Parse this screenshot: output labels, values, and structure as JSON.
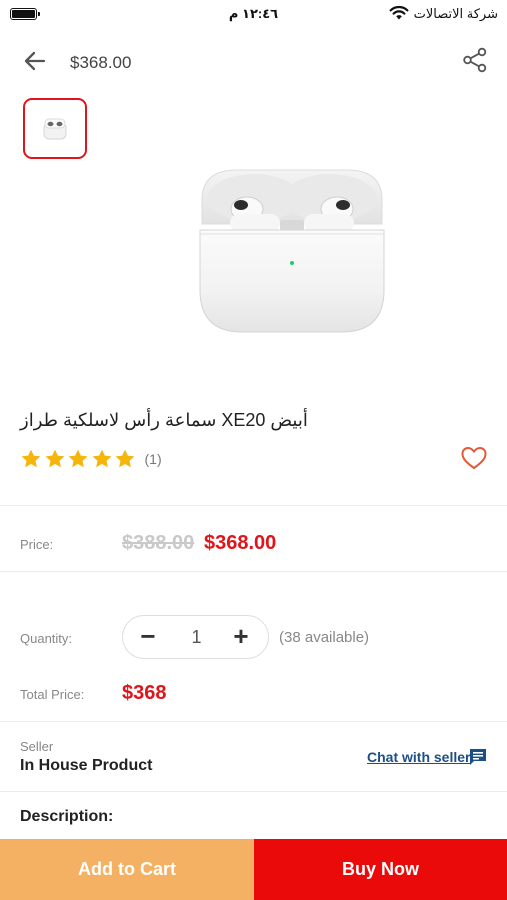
{
  "status_bar": {
    "carrier": "شركة الاتصالات",
    "time": "١٢:٤٦ م",
    "battery_icon": "battery-icon",
    "wifi_icon": "wifi-icon"
  },
  "header": {
    "price": "$368.00",
    "back_icon": "arrow-left-icon",
    "share_icon": "share-icon"
  },
  "product": {
    "title": "أبيض XE20 سماعة رأس لاسلكية طراز",
    "rating": 5,
    "rating_count": "(1)",
    "image_subject": "airpods-pro-case"
  },
  "price_section": {
    "label": "Price:",
    "old_price": "$388.00",
    "new_price": "$368.00"
  },
  "quantity_section": {
    "label": "Quantity:",
    "minus": "−",
    "value": "1",
    "plus": "+",
    "available": "(38 available)"
  },
  "total_section": {
    "label": "Total Price:",
    "value": "$368"
  },
  "seller_section": {
    "label": "Seller",
    "name": "In House Product",
    "chat_label": "Chat with seller"
  },
  "description": {
    "label": "Description:"
  },
  "actions": {
    "add_to_cart": "Add to Cart",
    "buy_now": "Buy Now"
  },
  "colors": {
    "accent_red": "#e0141b",
    "buy_button": "#ea0a0a",
    "cart_button": "#f5b163",
    "star": "#f5b50a",
    "heart": "#e35a3a",
    "chat_link": "#1d4f86"
  }
}
